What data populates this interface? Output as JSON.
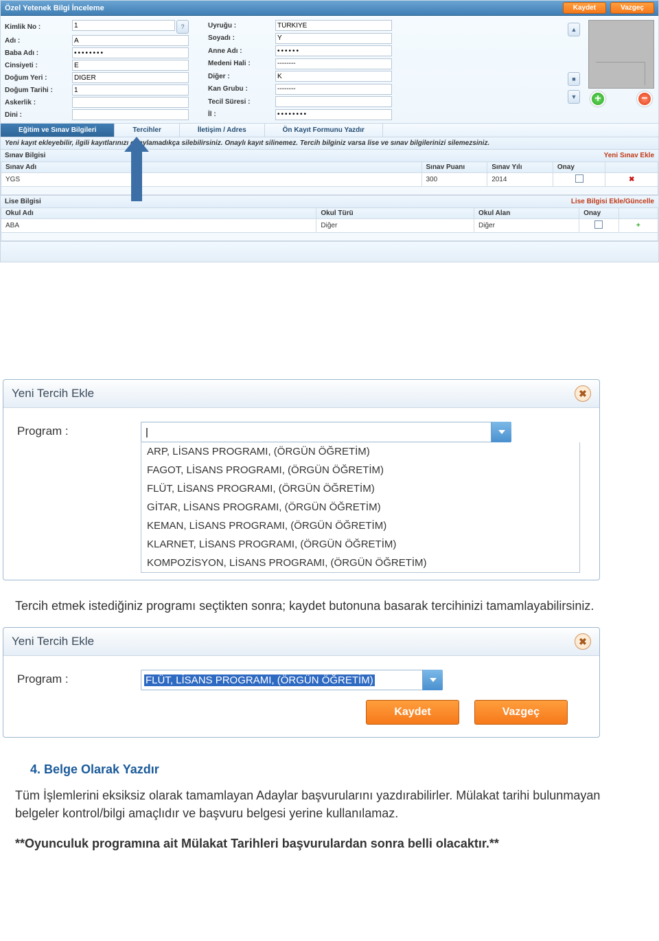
{
  "topPanel": {
    "title": "Özel Yetenek Bilgi İnceleme",
    "saveBtn": "Kaydet",
    "cancelBtn": "Vazgeç",
    "leftCol": {
      "kimlikNo": {
        "label": "Kimlik No :",
        "value": "1"
      },
      "adi": {
        "label": "Adı :",
        "value": "A"
      },
      "babaAdi": {
        "label": "Baba Adı :",
        "value": "••••••••"
      },
      "cinsiyeti": {
        "label": "Cinsiyeti :",
        "value": "E"
      },
      "dogumYeri": {
        "label": "Doğum Yeri :",
        "value": "DİĞER"
      },
      "dogumTarihi": {
        "label": "Doğum Tarihi :",
        "value": "1"
      },
      "askerlik": {
        "label": "Askerlik :",
        "value": ""
      },
      "dini": {
        "label": "Dini :",
        "value": ""
      }
    },
    "rightCol": {
      "uyrugu": {
        "label": "Uyruğu :",
        "value": "TÜRKİYE"
      },
      "soyadi": {
        "label": "Soyadı :",
        "value": "Y"
      },
      "anneAdi": {
        "label": "Anne Adı :",
        "value": "••••••"
      },
      "medeniHali": {
        "label": "Medeni Hali :",
        "value": "--------"
      },
      "diger": {
        "label": "Diğer :",
        "value": "K"
      },
      "kanGrubu": {
        "label": "Kan Grubu :",
        "value": "--------"
      },
      "tecilSuresi": {
        "label": "Tecil Süresi :",
        "value": ""
      },
      "il": {
        "label": "İl :",
        "value": "••••••••"
      }
    }
  },
  "tabs": {
    "t1": "Eğitim ve Sınav Bilgileri",
    "t2": "Tercihler",
    "t3": "İletişim / Adres",
    "t4": "Ön Kayıt Formunu Yazdır"
  },
  "infoStrip": "Yeni kayıt ekleyebilir, ilgili kayıtlarınızı onaylamadıkça silebilirsiniz. Onaylı kayıt silinemez. Tercih bilginiz varsa lise ve sınav bilgilerinizi silemezsiniz.",
  "sinav": {
    "title": "Sınav Bilgisi",
    "link": "Yeni Sınav Ekle",
    "headers": {
      "ad": "Sınav Adı",
      "puan": "Sınav Puanı",
      "yil": "Sınav Yılı",
      "onay": "Onay",
      "act": ""
    },
    "row": {
      "ad": "YGS",
      "puan": "300",
      "yil": "2014",
      "onay": ""
    }
  },
  "lise": {
    "title": "Lise Bilgisi",
    "link": "Lise Bilgisi Ekle/Güncelle",
    "headers": {
      "okul": "Okul Adı",
      "tur": "Okul Türü",
      "alan": "Okul Alan",
      "onay": "Onay",
      "act": ""
    },
    "row": {
      "okul": "ABA",
      "tur": "Diğer",
      "alan": "Diğer"
    }
  },
  "dialog1": {
    "title": "Yeni Tercih Ekle",
    "programLabel": "Program :",
    "options": [
      "ARP, LİSANS PROGRAMI, (ÖRGÜN ÖĞRETİM)",
      "FAGOT, LİSANS PROGRAMI, (ÖRGÜN ÖĞRETİM)",
      "FLÜT, LİSANS PROGRAMI, (ÖRGÜN ÖĞRETİM)",
      "GİTAR, LİSANS PROGRAMI, (ÖRGÜN ÖĞRETİM)",
      "KEMAN, LİSANS PROGRAMI, (ÖRGÜN ÖĞRETİM)",
      "KLARNET, LİSANS PROGRAMI, (ÖRGÜN ÖĞRETİM)",
      "KOMPOZİSYON, LİSANS PROGRAMI, (ÖRGÜN ÖĞRETİM)"
    ]
  },
  "docText": {
    "p1": "Tercih etmek istediğiniz programı seçtikten sonra; kaydet butonuna basarak tercihinizi tamamlayabilirsiniz."
  },
  "dialog2": {
    "title": "Yeni Tercih Ekle",
    "programLabel": "Program :",
    "selected": "FLÜT, LİSANS PROGRAMI, (ÖRGÜN ÖĞRETİM)",
    "saveBtn": "Kaydet",
    "cancelBtn": "Vazgeç"
  },
  "docText2": {
    "h4": "4.    Belge Olarak Yazdır",
    "p2": "Tüm İşlemlerini eksiksiz olarak tamamlayan  Adaylar başvurularını yazdırabilirler. Mülakat tarihi bulunmayan belgeler kontrol/bilgi amaçlıdır ve başvuru belgesi yerine kullanılamaz.",
    "p3": "**Oyunculuk programına ait Mülakat Tarihleri başvurulardan sonra belli olacaktır.**"
  }
}
